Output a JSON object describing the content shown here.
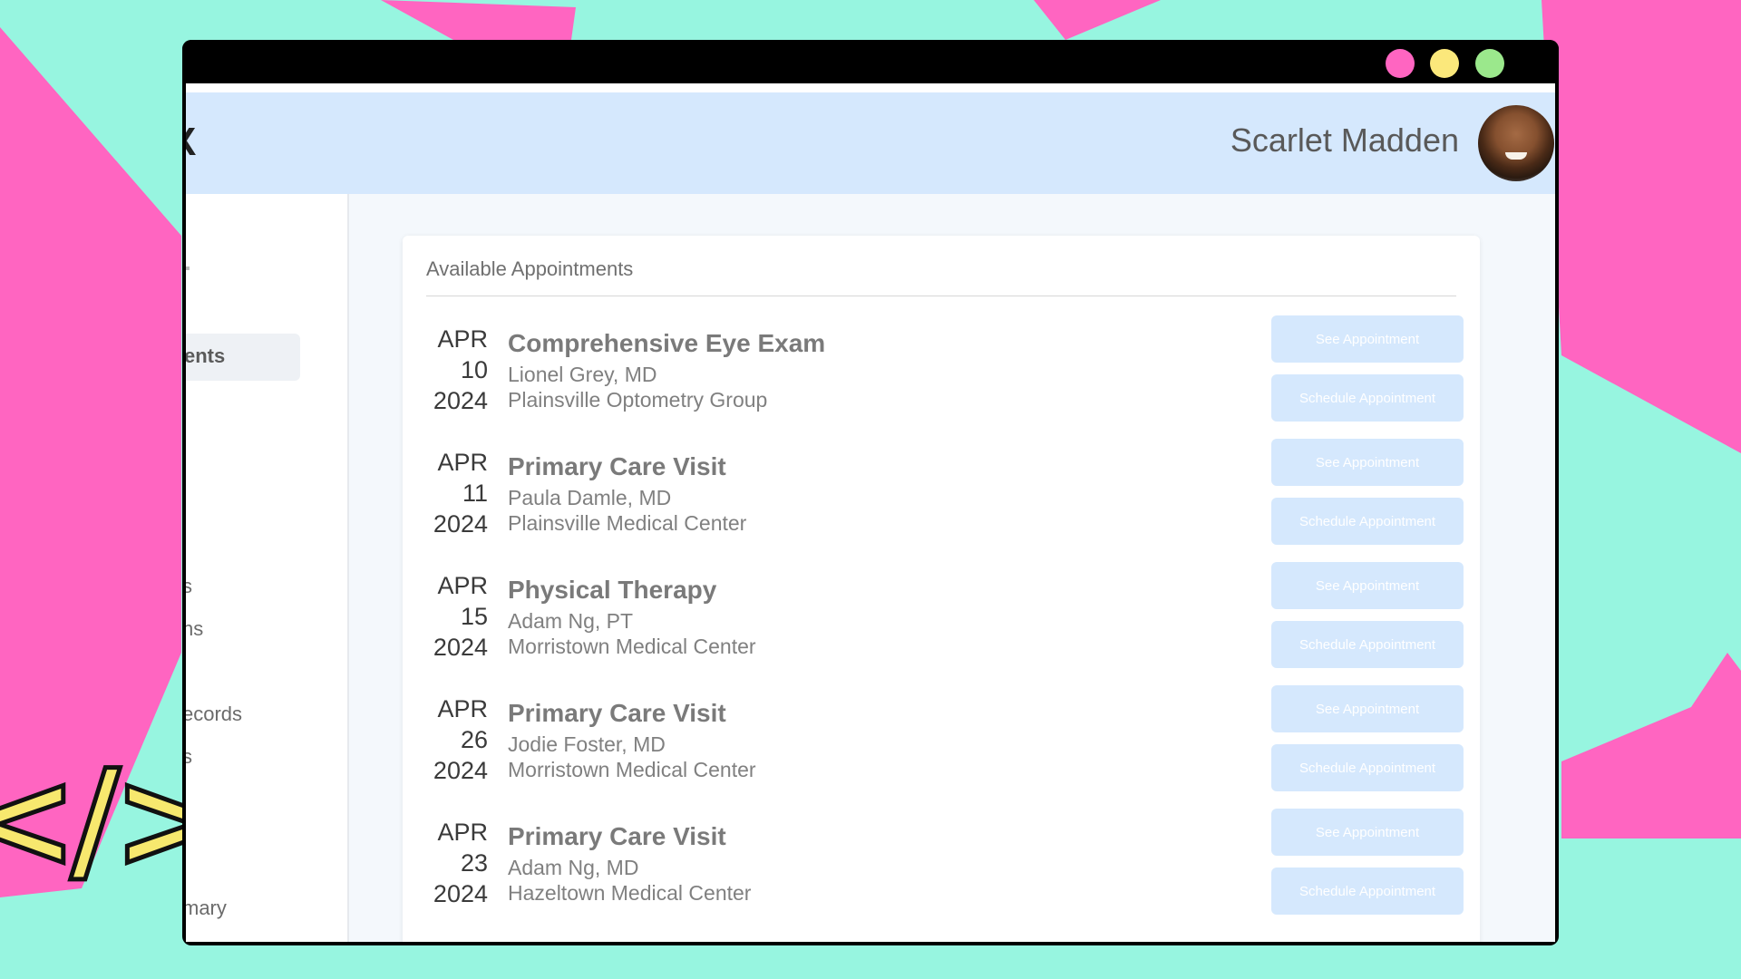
{
  "app": {
    "logo_fragment": "X"
  },
  "header": {
    "user_name": "Scarlet Madden",
    "avatar_icon": "user-avatar-photo"
  },
  "sidebar": {
    "items": [
      {
        "label": "ents"
      },
      {
        "label": "s"
      },
      {
        "label": "ns"
      },
      {
        "label": "ecords"
      },
      {
        "label": "s"
      },
      {
        "label": "mary"
      }
    ]
  },
  "main": {
    "card_title": "Available Appointments",
    "appointments": [
      {
        "month": "APR",
        "day": "10",
        "year": "2024",
        "title": "Comprehensive Eye Exam",
        "doctor": "Lionel Grey, MD",
        "location": "Plainsville Optometry Group",
        "see_label": "See Appointment",
        "schedule_label": "Schedule Appointment"
      },
      {
        "month": "APR",
        "day": "11",
        "year": "2024",
        "title": "Primary Care Visit",
        "doctor": "Paula Damle, MD",
        "location": "Plainsville Medical Center",
        "see_label": "See Appointment",
        "schedule_label": "Schedule Appointment"
      },
      {
        "month": "APR",
        "day": "15",
        "year": "2024",
        "title": "Physical Therapy",
        "doctor": "Adam Ng, PT",
        "location": "Morristown Medical Center",
        "see_label": "See Appointment",
        "schedule_label": "Schedule Appointment"
      },
      {
        "month": "APR",
        "day": "26",
        "year": "2024",
        "title": "Primary Care Visit",
        "doctor": "Jodie Foster, MD",
        "location": "Morristown Medical Center",
        "see_label": "See Appointment",
        "schedule_label": "Schedule Appointment"
      },
      {
        "month": "APR",
        "day": "23",
        "year": "2024",
        "title": "Primary Care Visit",
        "doctor": "Adam Ng, MD",
        "location": "Hazeltown Medical Center",
        "see_label": "See Appointment",
        "schedule_label": "Schedule Appointment"
      }
    ]
  },
  "decor": {
    "code_symbol": "</>",
    "colors": {
      "background": "#97f5e0",
      "accent_pink": "#ff65c1",
      "code_yellow": "#f7e86e",
      "button_blue": "#d5e8fd"
    }
  }
}
